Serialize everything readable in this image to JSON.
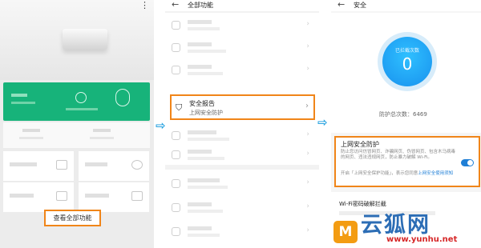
{
  "panel1": {
    "more_icon": "more-vertical-icon",
    "view_all_label": "查看全部功能"
  },
  "panel2": {
    "title": "全部功能",
    "highlighted_item": {
      "label": "安全报告",
      "subtitle": "上网安全防护",
      "icon": "shield-icon"
    }
  },
  "panel3": {
    "title": "安全",
    "blocked_label": "已拦截次数",
    "blocked_value": "0",
    "total_label": "防护总次数：6469",
    "protection": {
      "title": "上网安全防护",
      "description": "防止您访问仿冒网页、诈骗网页、伪冒网页、包含木马病毒的网页、违法违规网页，防止暴力破解 Wi-Fi。",
      "hint_prefix": "开启「上网安全保护功能」，表示您同意",
      "hint_link": "上网安全使用须知",
      "enabled": true
    },
    "wifi_section_title": "Wi-Fi密码破解拦截"
  },
  "arrows": [
    "⇨",
    "⇨"
  ],
  "watermark": {
    "logo_glyph": "M",
    "brand": "云狐网",
    "url": "www.yunhu.net",
    "brand_color": "#2c6db5",
    "url_color": "#d62728"
  },
  "colors": {
    "highlight": "#f08519",
    "card_green": "#17b37a",
    "accent_blue": "#1f7fd6"
  }
}
